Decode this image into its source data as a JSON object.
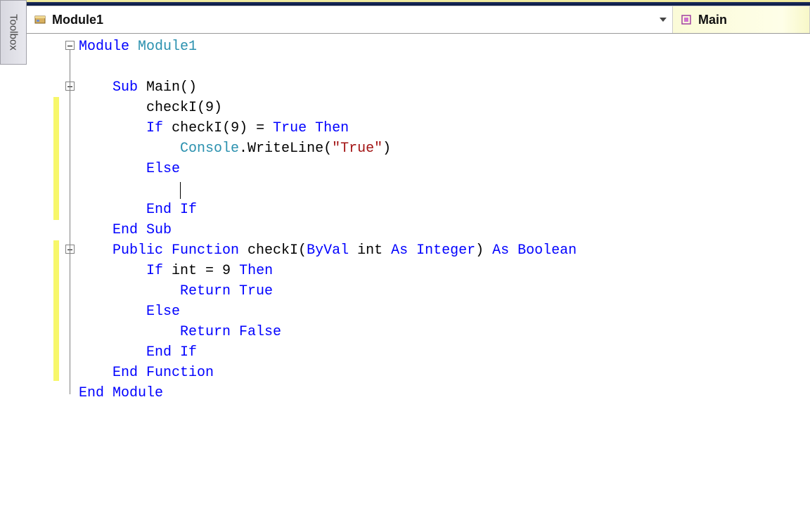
{
  "toolbox_label": "Toolbox",
  "class_dropdown": "Module1",
  "method_dropdown": "Main",
  "code": {
    "l1": {
      "kw1": "Module",
      "id": "Module1"
    },
    "l3": {
      "kw1": "Sub",
      "id": "Main()"
    },
    "l4": {
      "txt": "checkI(9)"
    },
    "l5": {
      "kw1": "If",
      "mid": "checkI(9) = ",
      "kw2": "True Then"
    },
    "l6": {
      "typ": "Console",
      "rest": ".WriteLine(",
      "str": "\"True\"",
      "close": ")"
    },
    "l7": {
      "kw": "Else"
    },
    "l9": {
      "kw": "End If"
    },
    "l10": {
      "kw": "End Sub"
    },
    "l11": {
      "kw1": "Public Function",
      "id": " checkI(",
      "kw2": "ByVal",
      "id2": " int ",
      "kw3": "As Integer",
      "id3": ") ",
      "kw4": "As Boolean"
    },
    "l12": {
      "kw1": "If",
      "mid": " int = 9 ",
      "kw2": "Then"
    },
    "l13": {
      "kw": "Return True"
    },
    "l14": {
      "kw": "Else"
    },
    "l15": {
      "kw": "Return False"
    },
    "l16": {
      "kw": "End If"
    },
    "l17": {
      "kw": "End Function"
    },
    "l18": {
      "kw": "End Module"
    }
  }
}
